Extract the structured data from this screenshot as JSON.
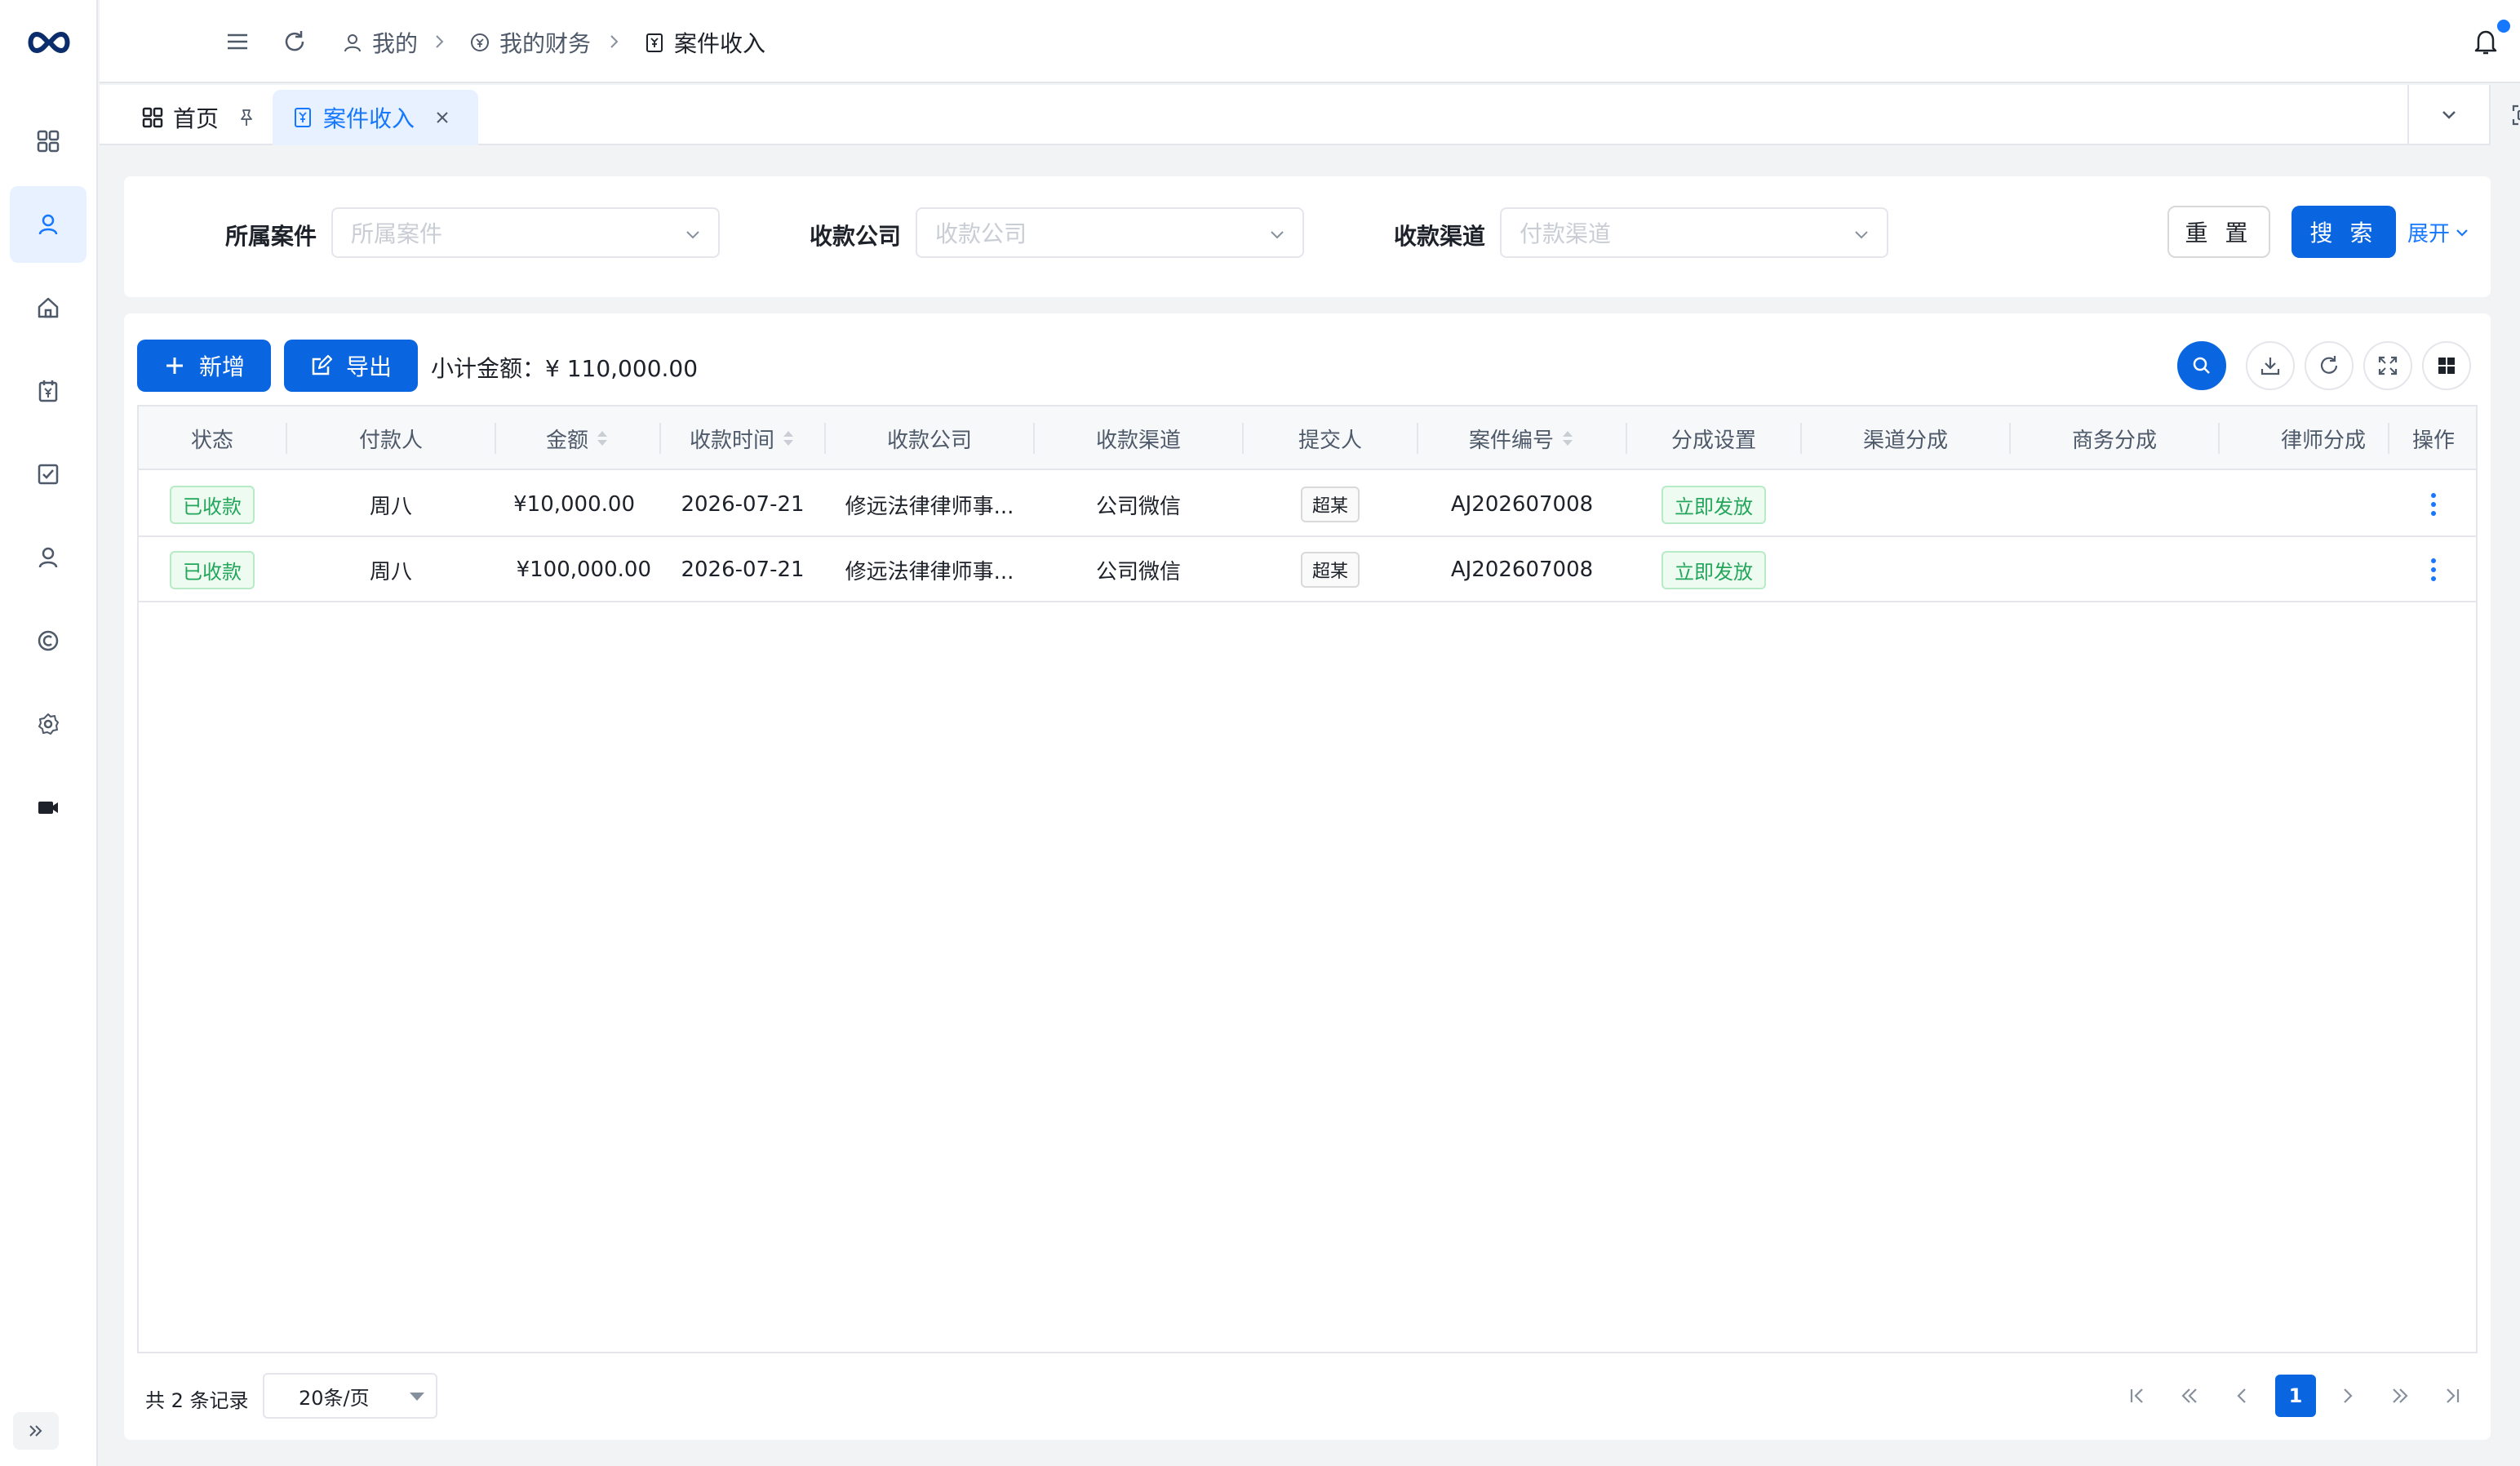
{
  "breadcrumb": [
    {
      "label": "我的",
      "icon": "user-icon"
    },
    {
      "label": "我的财务",
      "icon": "finance-icon"
    },
    {
      "label": "案件收入",
      "icon": "income-icon"
    }
  ],
  "tabs": [
    {
      "label": "首页",
      "icon": "dashboard-icon",
      "active": false
    },
    {
      "label": "案件收入",
      "icon": "income-icon",
      "active": true
    }
  ],
  "sidebar": {
    "items": [
      {
        "icon": "dashboard-icon",
        "active": false
      },
      {
        "icon": "user-icon",
        "active": true
      },
      {
        "icon": "home-icon",
        "active": false
      },
      {
        "icon": "finance-calendar-icon",
        "active": false
      },
      {
        "icon": "task-check-icon",
        "active": false
      },
      {
        "icon": "person-icon",
        "active": false
      },
      {
        "icon": "copyright-icon",
        "active": false
      },
      {
        "icon": "settings-icon",
        "active": false
      },
      {
        "icon": "video-icon",
        "active": false
      }
    ]
  },
  "filters": [
    {
      "label": "所属案件",
      "placeholder": "所属案件"
    },
    {
      "label": "收款公司",
      "placeholder": "收款公司"
    },
    {
      "label": "收款渠道",
      "placeholder": "付款渠道"
    }
  ],
  "actions": {
    "reset": "重 置",
    "search": "搜 索",
    "expand": "展开",
    "add": "新增",
    "export": "导出"
  },
  "subtotal": "小计金额：¥ 110,000.00",
  "table": {
    "columns": [
      "状态",
      "付款人",
      "金额",
      "收款时间",
      "收款公司",
      "收款渠道",
      "提交人",
      "案件编号",
      "分成设置",
      "渠道分成",
      "商务分成",
      "律师分成",
      "操作"
    ],
    "rows": [
      {
        "status": "已收款",
        "payer": "周八",
        "amount": "¥10,000.00",
        "date": "2026-07-21",
        "company": "修远法律律师事...",
        "channel": "公司微信",
        "submitter": "超某",
        "case_no": "AJ202607008",
        "split": "立即发放",
        "channel_split": "",
        "biz_split": "",
        "lawyer_split": ""
      },
      {
        "status": "已收款",
        "payer": "周八",
        "amount": "¥100,000.00",
        "date": "2026-07-21",
        "company": "修远法律律师事...",
        "channel": "公司微信",
        "submitter": "超某",
        "case_no": "AJ202607008",
        "split": "立即发放",
        "channel_split": "",
        "biz_split": "",
        "lawyer_split": ""
      }
    ]
  },
  "pagination": {
    "total_text": "共 2 条记录",
    "page_size": "20条/页",
    "current_page": "1"
  },
  "colors": {
    "primary": "#0a66e0",
    "success": "#23a55a",
    "notification_dot": "#1677ff"
  }
}
